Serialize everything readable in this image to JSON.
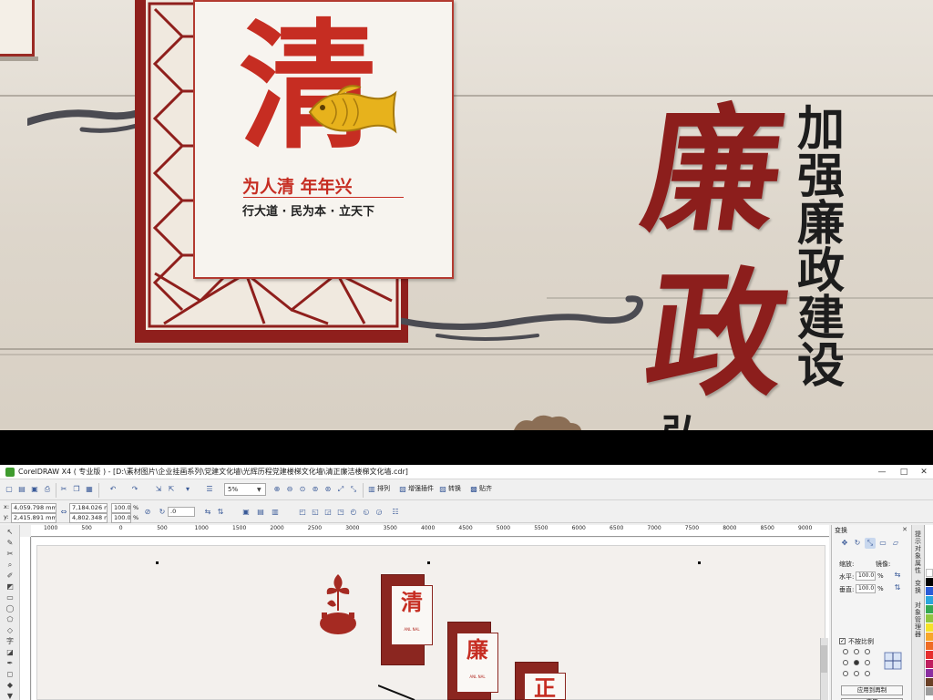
{
  "design": {
    "qing_char": "清",
    "slogan": "为人清  年年兴",
    "motto": "行大道 · 民为本 · 立天下",
    "vertical_title": [
      "加",
      "强",
      "廉",
      "政",
      "建",
      "设"
    ],
    "calligraphy_lian": "廉",
    "calligraphy_zheng": "政",
    "partial_text": "弘"
  },
  "app": {
    "title": "CorelDRAW X4 ( 专业版 ) - [D:\\素材图片\\企业挂画系列\\党建文化墙\\光辉历程党建楼梯文化墙\\清正廉洁楼梯文化墙.cdr]",
    "window_buttons": [
      "—",
      "□",
      "✕"
    ]
  },
  "toolbar": {
    "zoom": "5%",
    "labels": [
      "排列",
      "增强插件",
      "转换",
      "贴齐"
    ]
  },
  "propbar": {
    "x": "4,059.798 mm",
    "y": "2,415.891 mm",
    "w": "7,184.026 mm",
    "h": "4,802.348 mm",
    "scale_w": "100.0",
    "scale_h": "100.0",
    "pct": "%",
    "angle": ".0",
    "x_label": "x:",
    "y_label": "y:"
  },
  "ruler": {
    "ticks": [
      "1000",
      "500",
      "0",
      "500",
      "1000",
      "1500",
      "2000",
      "2500",
      "3000",
      "3500",
      "4000",
      "4500",
      "5000",
      "5500",
      "6000",
      "6500",
      "7000",
      "7500",
      "8000",
      "8500",
      "9000"
    ]
  },
  "docker": {
    "title": "变换",
    "close": "✕",
    "scale_label": "缩放:",
    "mirror_label": "镜像:",
    "h_label": "水平:",
    "v_label": "垂直:",
    "h_value": "100.0",
    "v_value": "100.0",
    "pct": "%",
    "nonprop_label": "不按比例",
    "apply_dup": "应用到再制",
    "apply": "应用"
  },
  "sidetabs": [
    "提示对象属性",
    "变换",
    "对象管理器"
  ],
  "drawing": {
    "chars": [
      "清",
      "廉",
      "正"
    ],
    "sub": "ANL NAL"
  },
  "palette": [
    "#ffffff",
    "#000000",
    "#2b5cd8",
    "#2aa6dd",
    "#35a853",
    "#8fc640",
    "#f4e229",
    "#f8a72a",
    "#ef6c24",
    "#e62e2e",
    "#c01f5f",
    "#8b2fa0",
    "#6b4026",
    "#9e9e9e"
  ]
}
